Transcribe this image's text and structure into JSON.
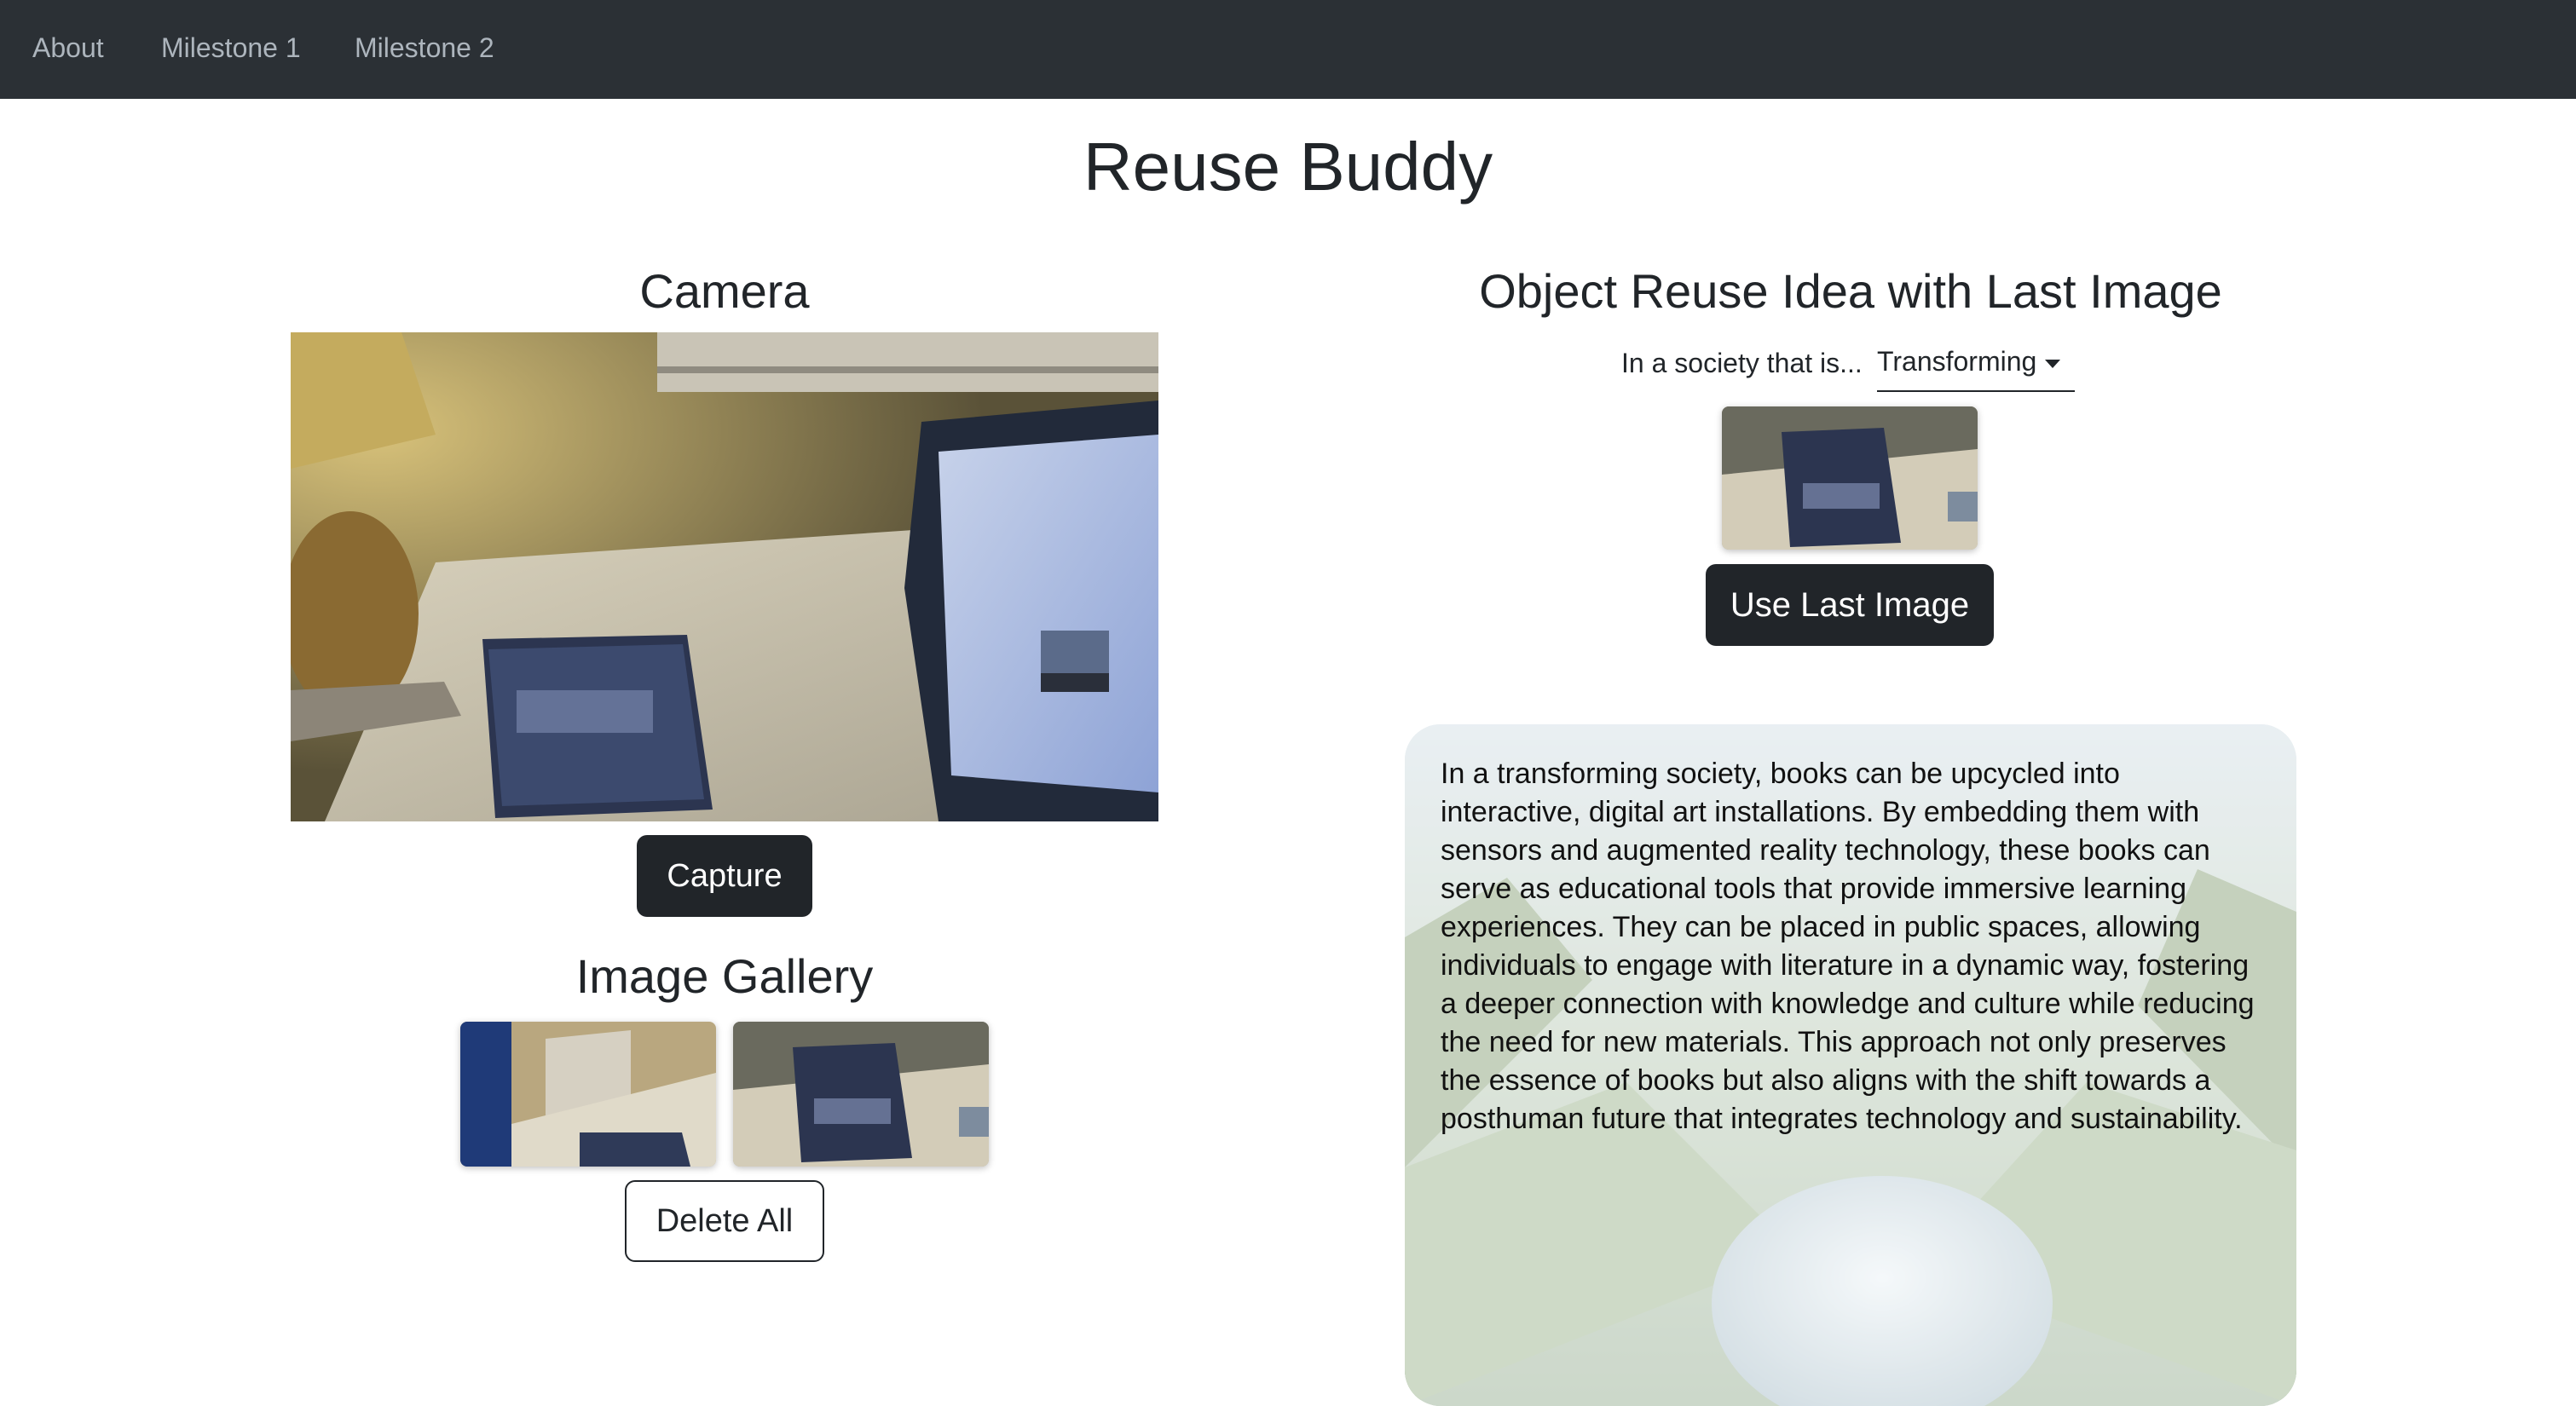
{
  "nav": {
    "items": [
      {
        "label": "About"
      },
      {
        "label": "Milestone 1"
      },
      {
        "label": "Milestone 2"
      }
    ]
  },
  "page_title": "Reuse Buddy",
  "camera": {
    "title": "Camera",
    "capture_label": "Capture"
  },
  "gallery": {
    "title": "Image Gallery",
    "delete_all_label": "Delete All"
  },
  "reuse": {
    "title": "Object Reuse Idea with Last Image",
    "society_prefix": "In a society that is...",
    "society_selected": "Transforming",
    "use_last_image_label": "Use Last Image",
    "idea_text": "In a transforming society, books can be upcycled into interactive, digital art installations. By embedding them with sensors and augmented reality technology, these books can serve as educational tools that provide immersive learning experiences. They can be placed in public spaces, allowing individuals to engage with literature in a dynamic way, fostering a deeper connection with knowledge and culture while reducing the need for new materials. This approach not only preserves the essence of books but also aligns with the shift towards a posthuman future that integrates technology and sustainability."
  },
  "colors": {
    "navbar_bg": "#2b3035",
    "nav_link": "#adb5bd",
    "button_dark": "#212529"
  }
}
